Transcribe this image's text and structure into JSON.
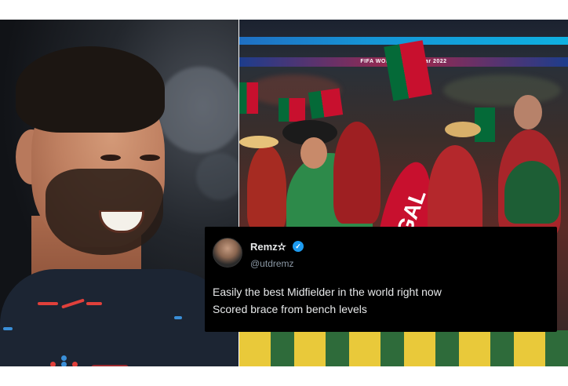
{
  "tweet": {
    "display_name": "Remz✫",
    "verified_icon": "verified-badge-icon",
    "handle": "@utdremz",
    "line1": "Easily the best Midfielder in the world right now",
    "line2": "Scored brace from bench levels",
    "verified_color": "#1d9bf0"
  },
  "stadium": {
    "banner_text": "FIFA WORLD CUP Qatar 2022"
  },
  "fan_banner": {
    "text": "GAL"
  },
  "colors": {
    "portugal_red": "#c8102e",
    "portugal_green": "#046a38"
  }
}
